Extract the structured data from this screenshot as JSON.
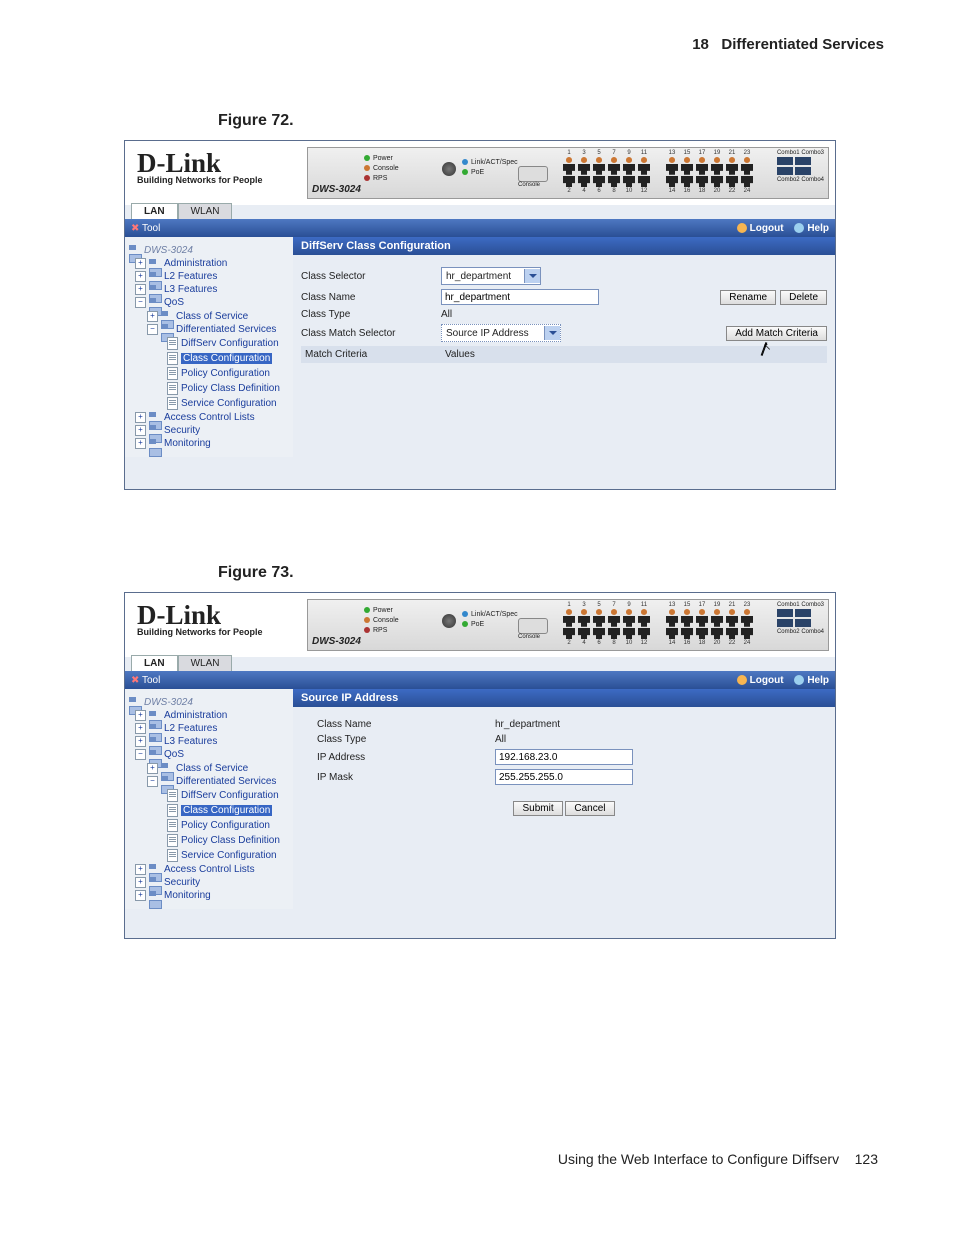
{
  "header": {
    "chapter_num": "18",
    "chapter_title": "Differentiated Services"
  },
  "captions": {
    "fig72": "Figure 72.",
    "fig73": "Figure 73."
  },
  "footer": {
    "text": "Using the Web Interface to Configure Diffserv",
    "page": "123"
  },
  "brand": {
    "name": "D-Link",
    "tagline": "Building Networks for People",
    "device": "DWS-3024"
  },
  "swpanel": {
    "leds1": [
      "Power",
      "Console",
      "RPS"
    ],
    "leds2": [
      "Link/ACT/Spec",
      "PoE"
    ],
    "console": "Console",
    "ports_top": [
      "1",
      "3",
      "5",
      "7",
      "9",
      "11"
    ],
    "ports_bot": [
      "2",
      "4",
      "6",
      "8",
      "10",
      "12"
    ],
    "ports2_top": [
      "13",
      "15",
      "17",
      "19",
      "21",
      "23"
    ],
    "ports2_bot": [
      "14",
      "16",
      "18",
      "20",
      "22",
      "24"
    ],
    "combo1": "Combo1 Combo3",
    "combo2": "Combo2 Combo4"
  },
  "tabs": {
    "lan": "LAN",
    "wlan": "WLAN"
  },
  "toolbar": {
    "tool": "Tool",
    "logout": "Logout",
    "help": "Help"
  },
  "tree": {
    "root": "DWS-3024",
    "admin": "Administration",
    "l2": "L2 Features",
    "l3": "L3 Features",
    "qos": "QoS",
    "cos": "Class of Service",
    "ds": "Differentiated Services",
    "ds_items": [
      "DiffServ Configuration",
      "Class Configuration",
      "Policy Configuration",
      "Policy Class Definition",
      "Service Configuration"
    ],
    "acl": "Access Control Lists",
    "sec": "Security",
    "mon": "Monitoring"
  },
  "fig72": {
    "title": "DiffServ Class Configuration",
    "labels": {
      "sel": "Class Selector",
      "name": "Class Name",
      "type": "Class Type",
      "match": "Class Match Selector",
      "crit": "Match Criteria",
      "vals": "Values"
    },
    "sel_value": "hr_department",
    "name_value": "hr_department",
    "type_value": "All",
    "match_value": "Source IP Address",
    "buttons": {
      "rename": "Rename",
      "delete": "Delete",
      "add": "Add Match Criteria"
    }
  },
  "fig73": {
    "title": "Source IP Address",
    "labels": {
      "name": "Class Name",
      "type": "Class Type",
      "ip": "IP Address",
      "mask": "IP Mask"
    },
    "name_value": "hr_department",
    "type_value": "All",
    "ip_value": "192.168.23.0",
    "mask_value": "255.255.255.0",
    "buttons": {
      "submit": "Submit",
      "cancel": "Cancel"
    }
  }
}
